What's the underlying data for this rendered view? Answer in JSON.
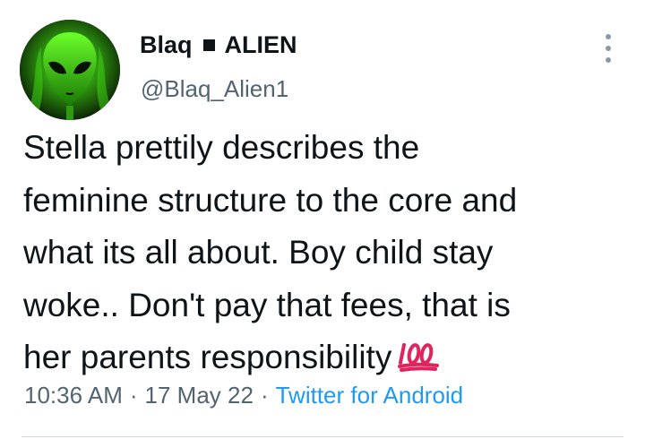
{
  "author": {
    "name_first": "Blaq",
    "name_second": "ALIEN",
    "handle": "@Blaq_Alien1",
    "avatar_icon": "alien-head-icon",
    "avatar_color": "#39c21a"
  },
  "menu": {
    "icon": "more-vertical-icon"
  },
  "tweet": {
    "text": "Stella prettily describes the\nfeminine structure to the core and\nwhat its all about. Boy child stay\nwoke.. Don't pay that fees, that is\nher parents responsibility",
    "emoji": "100-points-emoji",
    "emoji_color": "#e0245e"
  },
  "meta": {
    "time": "10:36 AM",
    "date": "17 May 22",
    "source": "Twitter for Android",
    "separator": "·",
    "link_color": "#1d9bf0"
  }
}
